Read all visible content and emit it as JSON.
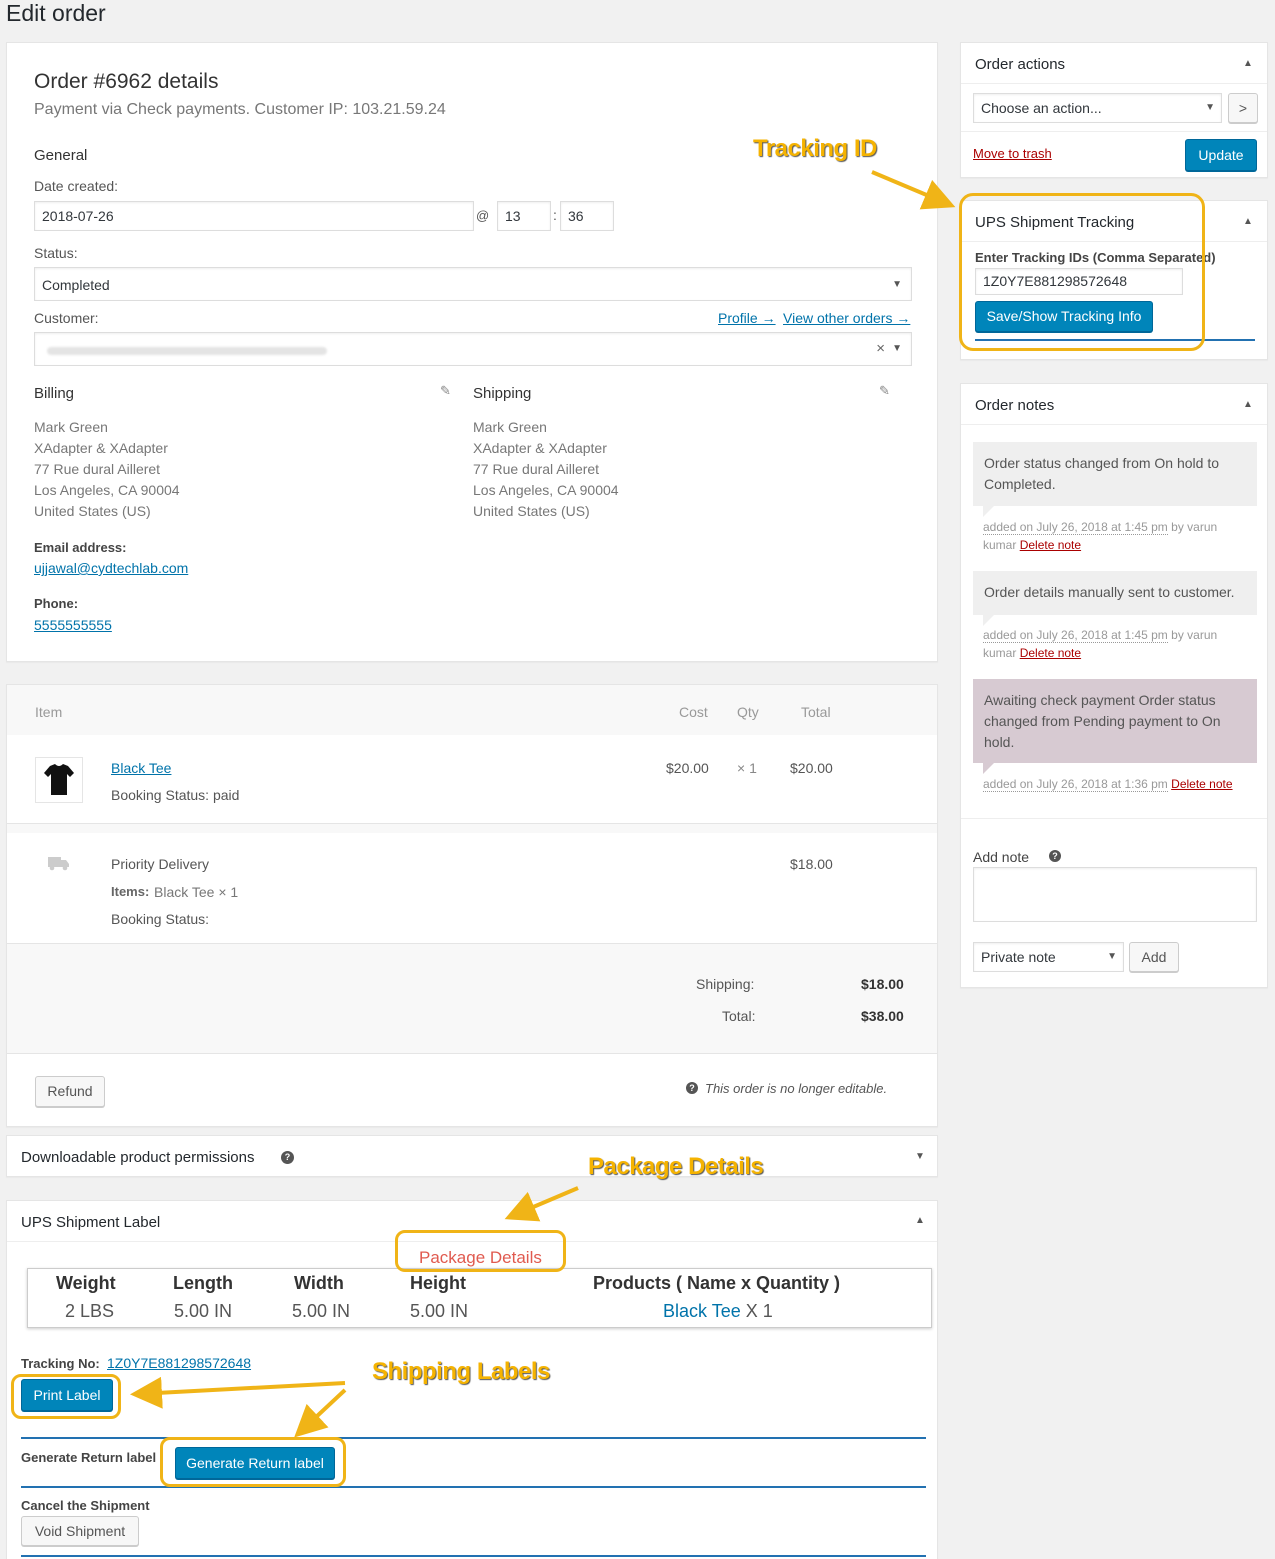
{
  "page_title": "Edit order",
  "order": {
    "heading": "Order #6962 details",
    "subtitle": "Payment via Check payments. Customer IP: 103.21.59.24",
    "general_label": "General",
    "date_label": "Date created:",
    "date_value": "2018-07-26",
    "at": "@",
    "hour": "13",
    "colon": ":",
    "minute": "36",
    "status_label": "Status:",
    "status_value": "Completed",
    "customer_label": "Customer:",
    "profile_link": "Profile →",
    "other_orders_link": "View other orders →",
    "customer_clear": "×"
  },
  "billing": {
    "title": "Billing",
    "lines": [
      "Mark Green",
      "XAdapter & XAdapter",
      "77 Rue dural Ailleret",
      "Los Angeles, CA 90004",
      "United States (US)"
    ],
    "email_label": "Email address:",
    "email": "ujjawal@cydtechlab.com",
    "phone_label": "Phone:",
    "phone": "5555555555"
  },
  "shipping": {
    "title": "Shipping",
    "lines": [
      "Mark Green",
      "XAdapter & XAdapter",
      "77 Rue dural Ailleret",
      "Los Angeles, CA 90004",
      "United States (US)"
    ]
  },
  "items": {
    "headers": {
      "item": "Item",
      "cost": "Cost",
      "qty": "Qty",
      "total": "Total"
    },
    "product": {
      "name": "Black Tee",
      "meta": "Booking Status: paid",
      "cost": "$20.00",
      "qty": "× 1",
      "total": "$20.00"
    },
    "shipping_line": {
      "name": "Priority Delivery",
      "items_label": "Items:",
      "items_value": "Black Tee × 1",
      "meta": "Booking Status:",
      "total": "$18.00"
    },
    "totals": {
      "shipping_label": "Shipping:",
      "shipping_value": "$18.00",
      "total_label": "Total:",
      "total_value": "$38.00"
    },
    "refund_button": "Refund",
    "not_editable": "This order is no longer editable."
  },
  "downloadable": {
    "title": "Downloadable product permissions"
  },
  "ups_label": {
    "title": "UPS Shipment Label",
    "package_caption": "Package Details",
    "headers": [
      "Weight",
      "Length",
      "Width",
      "Height",
      "Products ( Name x Quantity )"
    ],
    "row": {
      "weight": "2 LBS",
      "length": "5.00 IN",
      "width": "5.00 IN",
      "height": "5.00 IN",
      "product": "Black Tee",
      "qty": " X 1"
    },
    "tracking_label": "Tracking No:",
    "tracking_value": "1Z0Y7E881298572648",
    "print_label": "Print Label",
    "return_label_text": "Generate Return label :",
    "return_label_button": "Generate Return label",
    "cancel_text": "Cancel the Shipment",
    "void_button": "Void Shipment"
  },
  "order_actions": {
    "title": "Order actions",
    "select_value": "Choose an action...",
    "go": ">",
    "trash": "Move to trash",
    "update": "Update"
  },
  "ups_tracking": {
    "title": "UPS Shipment Tracking",
    "label": "Enter Tracking IDs (Comma Separated)",
    "value": "1Z0Y7E881298572648",
    "button": "Save/Show Tracking Info"
  },
  "order_notes": {
    "title": "Order notes",
    "notes": [
      {
        "text": "Order status changed from On hold to Completed.",
        "meta_added": "added on July 26, 2018 at 1:45 pm",
        "meta_by": " by varun kumar ",
        "delete": "Delete note"
      },
      {
        "text": "Order details manually sent to customer.",
        "meta_added": "added on July 26, 2018 at 1:45 pm",
        "meta_by": " by varun kumar ",
        "delete": "Delete note"
      },
      {
        "text": "Awaiting check payment Order status changed from Pending payment to On hold.",
        "meta_added": "added on July 26, 2018 at 1:36 pm",
        "meta_by": " ",
        "delete": "Delete note"
      }
    ],
    "add_note_label": "Add note",
    "note_type": "Private note",
    "add_button": "Add"
  },
  "annotations": {
    "tracking_id": "Tracking ID",
    "package_details": "Package Details",
    "shipping_labels": "Shipping Labels"
  },
  "colors": {
    "accent": "#0085ba",
    "highlight": "#f0b417",
    "link": "#0073aa",
    "delete": "#a00",
    "package_caption": "#e05a4f"
  }
}
